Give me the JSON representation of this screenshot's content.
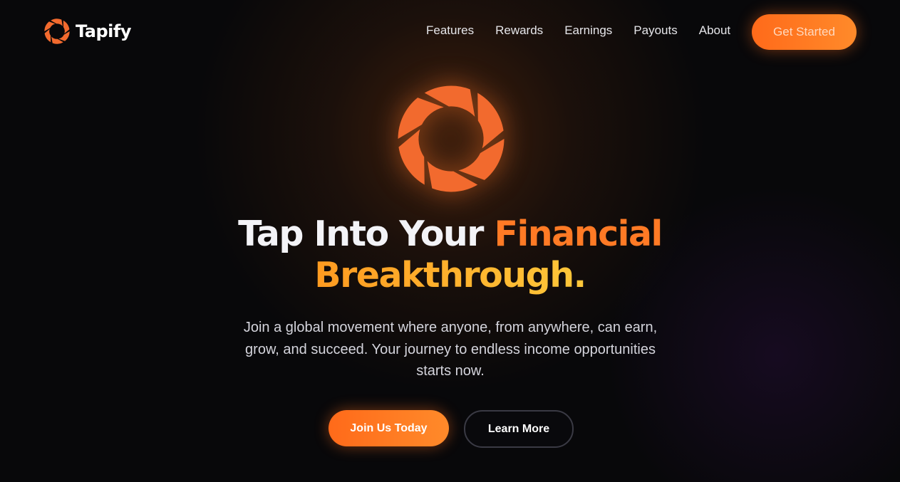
{
  "brand": {
    "name": "Tapify",
    "icon": "aperture-icon",
    "accent_color": "#f26a2e"
  },
  "nav": {
    "items": [
      {
        "label": "Features"
      },
      {
        "label": "Rewards"
      },
      {
        "label": "Earnings"
      },
      {
        "label": "Payouts"
      },
      {
        "label": "About"
      }
    ],
    "cta_label": "Get Started"
  },
  "hero": {
    "logo_icon": "aperture-icon",
    "headline": {
      "part1": "Tap Into Your ",
      "part2": "Financial",
      "part3": "Breakthrough."
    },
    "subtitle": "Join a global movement where anyone, from anywhere, can earn, grow, and succeed. Your journey to endless income opportunities starts now.",
    "primary_cta": "Join Us Today",
    "secondary_cta": "Learn More"
  },
  "colors": {
    "background": "#08080a",
    "primary_gradient_start": "#ff6a1a",
    "primary_gradient_end": "#ff8a2a",
    "headline_orange": "#ff7a25",
    "headline_gold": "#ffc83a"
  }
}
